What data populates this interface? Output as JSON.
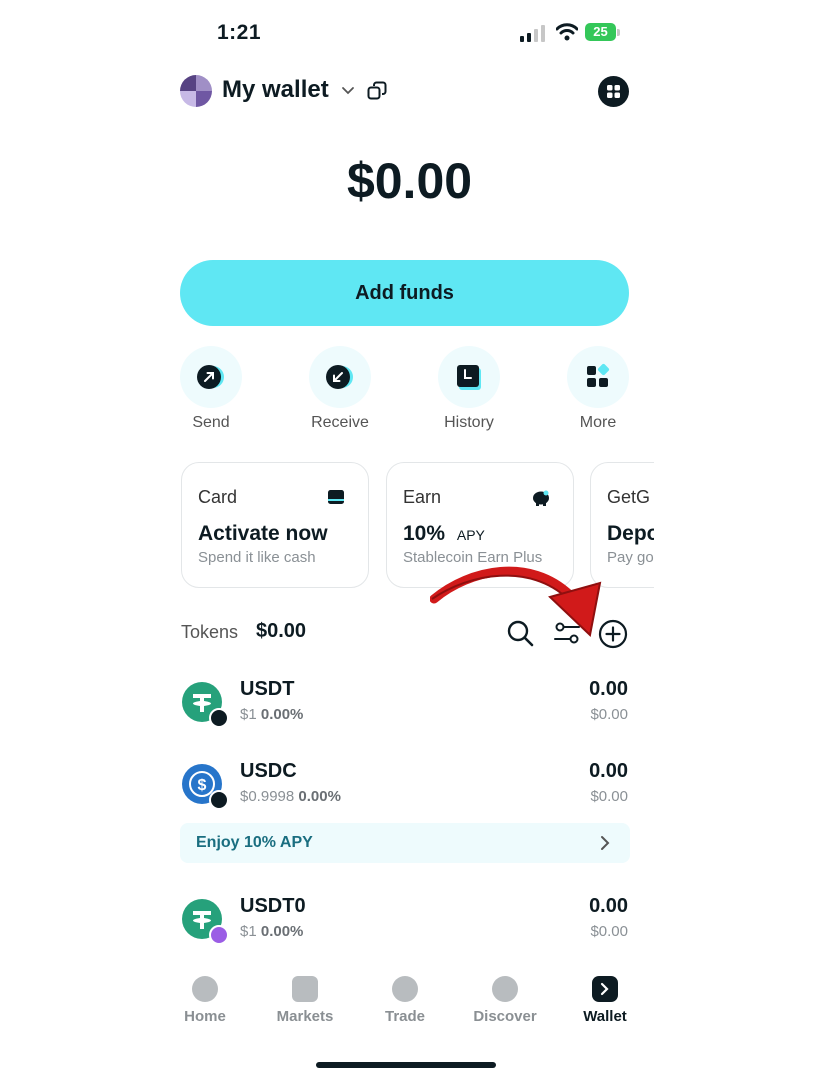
{
  "status_bar": {
    "time": "1:21",
    "battery": "25"
  },
  "header": {
    "wallet_name": "My wallet"
  },
  "balance": "$0.00",
  "add_funds_label": "Add funds",
  "quick_actions": [
    {
      "label": "Send",
      "icon": "send-arrow-icon"
    },
    {
      "label": "Receive",
      "icon": "receive-arrow-icon"
    },
    {
      "label": "History",
      "icon": "history-icon"
    },
    {
      "label": "More",
      "icon": "more-grid-icon"
    }
  ],
  "cards": [
    {
      "title": "Card",
      "main": "Activate now",
      "main_suffix": "",
      "sub": "Spend it like cash",
      "icon": "card-icon"
    },
    {
      "title": "Earn",
      "main": "10%",
      "main_suffix": "APY",
      "sub": "Stablecoin Earn Plus",
      "icon": "piggy-bank-icon"
    },
    {
      "title": "GetG",
      "main": "Depo",
      "main_suffix": "",
      "sub": "Pay go"
    }
  ],
  "tokens": {
    "label": "Tokens",
    "total": "$0.00",
    "items": [
      {
        "name": "USDT",
        "price": "$1",
        "change": "0.00%",
        "amount": "0.00",
        "value": "$0.00",
        "logo_color": "#26a17b",
        "badge_color": "#0d1b22"
      },
      {
        "name": "USDC",
        "price": "$0.9998",
        "change": "0.00%",
        "amount": "0.00",
        "value": "$0.00",
        "logo_color": "#2775ca",
        "badge_color": "#0d1b22"
      },
      {
        "name": "USDT0",
        "price": "$1",
        "change": "0.00%",
        "amount": "0.00",
        "value": "$0.00",
        "logo_color": "#26a17b",
        "badge_color": "#9b5de5"
      }
    ]
  },
  "apy_banner": "Enjoy 10% APY",
  "bottom_nav": [
    {
      "label": "Home",
      "active": false
    },
    {
      "label": "Markets",
      "active": false
    },
    {
      "label": "Trade",
      "active": false
    },
    {
      "label": "Discover",
      "active": false
    },
    {
      "label": "Wallet",
      "active": true
    }
  ],
  "colors": {
    "accent": "#5fe7f3",
    "arrow": "#d11a1a",
    "text": "#0d1b22"
  }
}
